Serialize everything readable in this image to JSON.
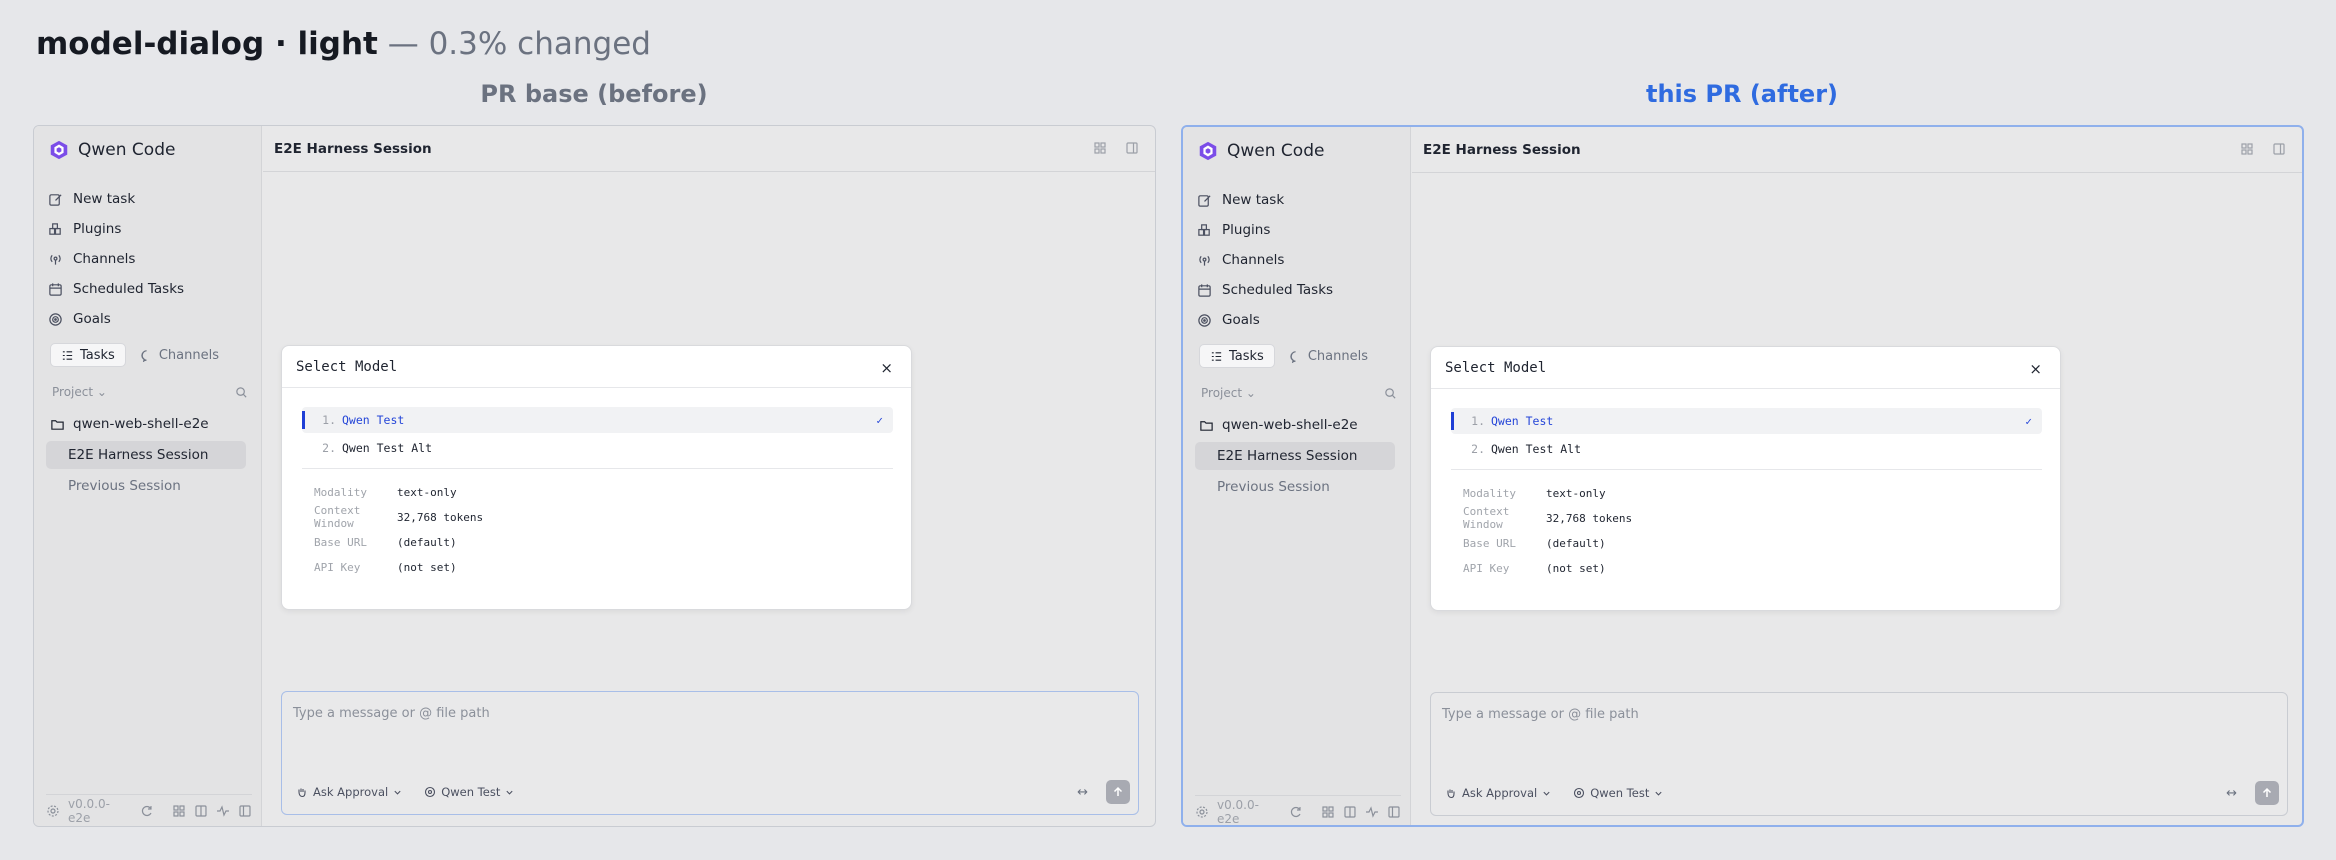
{
  "page": {
    "title": "model-dialog · light",
    "subtitle": " — 0.3% changed"
  },
  "panels": {
    "before_heading": "PR base (before)",
    "after_heading": "this PR (after)"
  },
  "app": {
    "brand": "Qwen Code",
    "nav": [
      {
        "label": "New task",
        "icon": "edit-icon"
      },
      {
        "label": "Plugins",
        "icon": "plugin-icon"
      },
      {
        "label": "Channels",
        "icon": "broadcast-icon"
      },
      {
        "label": "Scheduled Tasks",
        "icon": "calendar-clock-icon"
      },
      {
        "label": "Goals",
        "icon": "target-icon"
      }
    ],
    "segments": {
      "tasks": "Tasks",
      "channels": "Channels"
    },
    "project_label": "Project",
    "folder": "qwen-web-shell-e2e",
    "sessions": [
      "E2E Harness Session",
      "Previous Session"
    ],
    "version": "v0.0.0-e2e",
    "session_title": "E2E Harness Session"
  },
  "dialog": {
    "title": "Select Model",
    "close": "×",
    "options": [
      {
        "num": "1.",
        "name": "Qwen Test",
        "selected": true,
        "check": "✓"
      },
      {
        "num": "2.",
        "name": "Qwen Test Alt",
        "selected": false
      }
    ],
    "details": [
      {
        "key": "Modality",
        "value": "text-only"
      },
      {
        "key": "Context Window",
        "value": "32,768 tokens"
      },
      {
        "key": "Base URL",
        "value": "(default)"
      },
      {
        "key": "API Key",
        "value": "(not set)"
      }
    ]
  },
  "composer": {
    "placeholder": "Type a message or @ file path",
    "approval": "Ask Approval",
    "model": "Qwen Test",
    "expand": "↔"
  },
  "colors": {
    "accent": "#2f6be0",
    "selected_option": "#2546d8",
    "background": "#e6e7ea"
  }
}
